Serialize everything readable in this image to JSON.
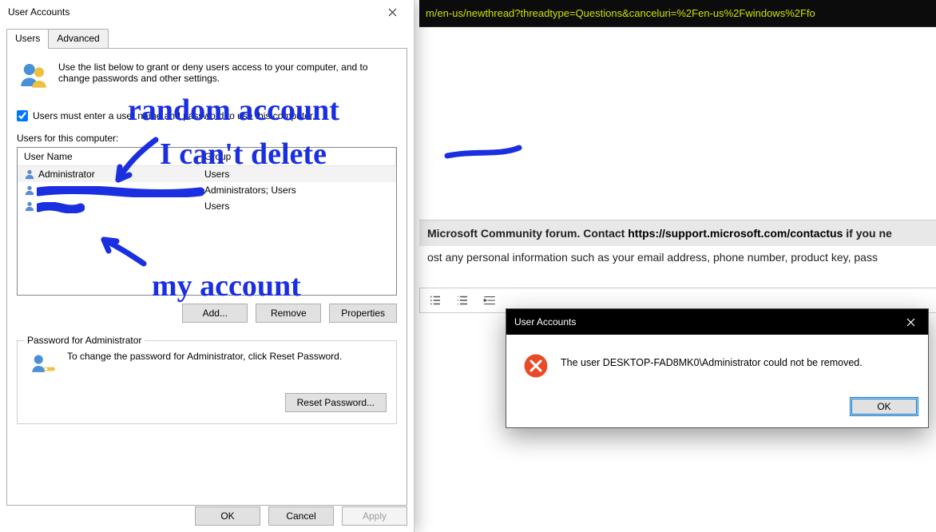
{
  "addressbar": {
    "fragment": "m/en-us/newthread?threadtype=Questions&canceluri=%2Fen-us%2Fwindows%2Ffo"
  },
  "community": {
    "line1_prefix": "Microsoft Community forum. Contact ",
    "line1_link": "https://support.microsoft.com/contactus",
    "line1_suffix": " if you ne",
    "line2": "ost any personal information such as your email address, phone number, product key, pass"
  },
  "ua_dialog": {
    "title": "User Accounts",
    "tabs": {
      "users": "Users",
      "advanced": "Advanced"
    },
    "intro": "Use the list below to grant or deny users access to your computer, and to change passwords and other settings.",
    "checkbox_label": "Users must enter a user name and password to use this computer.",
    "users_label": "Users for this computer:",
    "columns": {
      "name": "User Name",
      "group": "Group"
    },
    "rows": [
      {
        "name": "Administrator",
        "group": "Users",
        "selected": true
      },
      {
        "name": "████████████",
        "group": "Administrators; Users",
        "selected": false
      },
      {
        "name": "████",
        "group": "Users",
        "selected": false
      }
    ],
    "buttons": {
      "add": "Add...",
      "remove": "Remove",
      "properties": "Properties"
    },
    "password_group": {
      "label": "Password for Administrator",
      "text": "To change the password for Administrator, click Reset Password.",
      "reset": "Reset Password..."
    },
    "footer": {
      "ok": "OK",
      "cancel": "Cancel",
      "apply": "Apply"
    }
  },
  "error_dialog": {
    "title": "User Accounts",
    "message": "The user DESKTOP-FAD8MK0\\Administrator could not be removed.",
    "ok": "OK"
  },
  "handwriting": {
    "line1": "random account",
    "line2": "I can't delete",
    "line3": "my account"
  }
}
